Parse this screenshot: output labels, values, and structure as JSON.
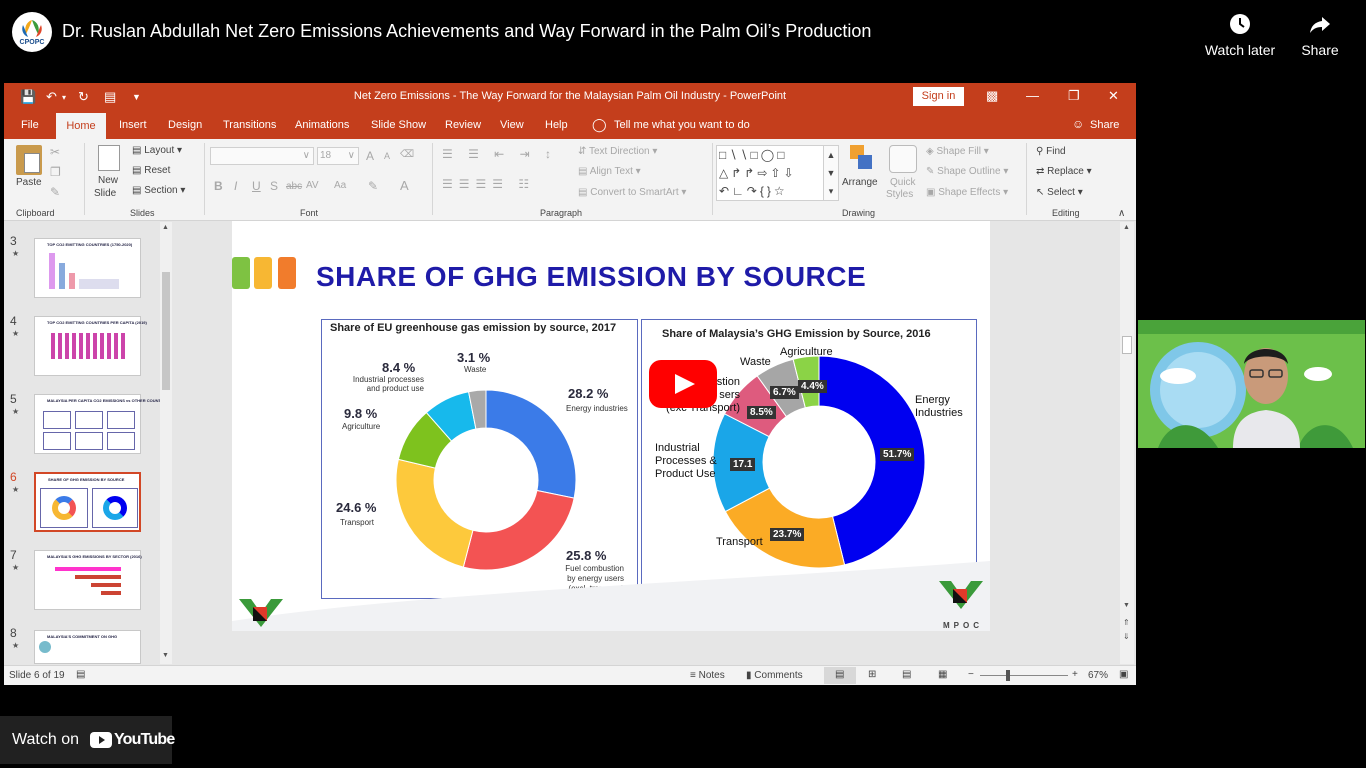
{
  "youtube": {
    "channel_logo_text": "CPOPC",
    "video_title": "Dr. Ruslan Abdullah Net Zero Emissions Achievements and Way Forward in the Palm Oil’s Production",
    "watch_later_label": "Watch later",
    "share_label": "Share",
    "watch_on_label": "Watch on",
    "youtube_wordmark": "YouTube",
    "play_button": "play-icon"
  },
  "powerpoint": {
    "window_title": "Net Zero Emissions - The Way Forward for the Malaysian Palm Oil Industry  -  PowerPoint",
    "sign_in_label": "Sign in",
    "tabs": [
      "File",
      "Home",
      "Insert",
      "Design",
      "Transitions",
      "Animations",
      "Slide Show",
      "Review",
      "View",
      "Help"
    ],
    "tell_me": "Tell me what you want to do",
    "share_label": "Share",
    "ribbon": {
      "clipboard": {
        "paste": "Paste",
        "group": "Clipboard"
      },
      "slides": {
        "new_slide_1": "New",
        "new_slide_2": "Slide",
        "layout": "Layout",
        "reset": "Reset",
        "section": "Section",
        "group": "Slides"
      },
      "font": {
        "size": "18",
        "bold": "B",
        "italic": "I",
        "underline": "U",
        "shadow": "S",
        "strike": "abc",
        "spacing": "AV",
        "case": "Aa",
        "grow": "A",
        "shrink": "A",
        "color": "A",
        "group": "Font"
      },
      "paragraph": {
        "text_direction": "Text Direction",
        "align_text": "Align Text",
        "convert": "Convert to SmartArt",
        "group": "Paragraph"
      },
      "drawing": {
        "arrange": "Arrange",
        "quick_styles_1": "Quick",
        "quick_styles_2": "Styles",
        "shape_fill": "Shape Fill",
        "shape_outline": "Shape Outline",
        "shape_effects": "Shape Effects",
        "group": "Drawing"
      },
      "editing": {
        "find": "Find",
        "replace": "Replace",
        "select": "Select",
        "group": "Editing"
      }
    },
    "thumbnails": [
      {
        "num": "3",
        "title": "TOP CO2 EMITTING COUNTRIES (1750-2020)",
        "star": "★"
      },
      {
        "num": "4",
        "title": "TOP CO2 EMITTING COUNTRIES PER CAPITA (2019)",
        "star": "★"
      },
      {
        "num": "5",
        "title": "MALAYSIA PER CAPITA CO2 EMISSIONS vs OTHER COUNTRIES",
        "star": "★"
      },
      {
        "num": "6",
        "title": "SHARE OF GHG EMISSION BY SOURCE",
        "star": "★"
      },
      {
        "num": "7",
        "title": "MALAYSIA'S GHG EMISSIONS BY SECTOR (2016)",
        "star": "★"
      },
      {
        "num": "8",
        "title": "MALAYSIA'S COMMITMENT ON GHG",
        "star": "★"
      }
    ],
    "status": {
      "slide_counter": "Slide 6 of 19",
      "notes": "Notes",
      "comments": "Comments",
      "zoom": "67%",
      "minus": "−",
      "plus": "+"
    }
  },
  "slide": {
    "title": "SHARE OF GHG EMISSION BY SOURCE",
    "logo_text": "MPOC",
    "colors": {
      "accent_green": "#7ec242",
      "accent_yellow": "#f7b733",
      "accent_orange": "#f17c2c",
      "title_blue": "#1f1ba8"
    }
  },
  "chart_data": [
    {
      "type": "pie",
      "title": "Share of EU greenhouse gas emission by source, 2017",
      "donut": true,
      "slices": [
        {
          "label": "Energy industries",
          "value": 28.2,
          "value_label": "28.2 %",
          "color": "#3b7be8"
        },
        {
          "label_lines": [
            "Fuel combustion",
            "by energy users",
            "(excl. transport)"
          ],
          "value": 25.8,
          "value_label": "25.8 %",
          "color": "#f35353"
        },
        {
          "label": "Transport",
          "value": 24.6,
          "value_label": "24.6 %",
          "color": "#fdc93c"
        },
        {
          "label": "Agriculture",
          "value": 9.8,
          "value_label": "9.8 %",
          "color": "#7ec21e"
        },
        {
          "label_lines": [
            "Industrial processes",
            "and product use"
          ],
          "value": 8.4,
          "value_label": "8.4 %",
          "color": "#17b9ec"
        },
        {
          "label": "Waste",
          "value": 3.1,
          "value_label": "3.1 %",
          "color": "#a9a9a9"
        }
      ]
    },
    {
      "type": "pie",
      "title": "Share of Malaysia’s GHG Emission by Source, 2016",
      "donut": true,
      "slices": [
        {
          "label_lines": [
            "Energy",
            "Industries"
          ],
          "value": 51.7,
          "value_label": "51.7%",
          "color": "#0000f0"
        },
        {
          "label": "Transport",
          "value": 23.7,
          "value_label": "23.7%",
          "color": "#fbab25"
        },
        {
          "label_lines": [
            "Industrial",
            "Processes &",
            "Product Use"
          ],
          "value": 17.1,
          "value_label": "17.1",
          "color": "#1aa6e8"
        },
        {
          "label_lines": [
            "stion",
            "sers",
            "(exc Transport)"
          ],
          "value": 8.5,
          "value_label": "8.5%",
          "color": "#de5b7e"
        },
        {
          "label": "Waste",
          "value": 6.7,
          "value_label": "6.7%",
          "color": "#a6a6a6"
        },
        {
          "label": "Agriculture",
          "value": 4.4,
          "value_label": "4.4%",
          "color": "#8bd346"
        }
      ]
    }
  ]
}
